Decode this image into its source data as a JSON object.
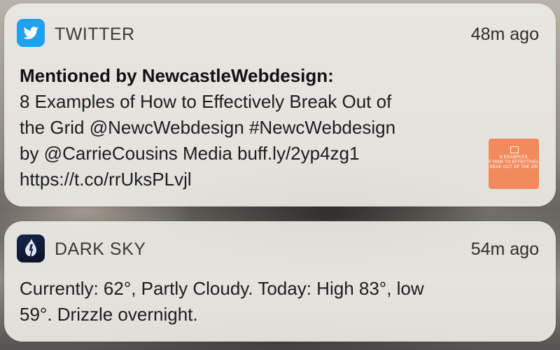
{
  "notifications": {
    "twitter": {
      "app_name": "TWITTER",
      "time": "48m ago",
      "title": "Mentioned by NewcastleWebdesign:",
      "lines": [
        "8 Examples of How to Effectively Break Out of",
        "the Grid @NewcWebdesign #NewcWebdesign",
        "by @CarrieCousins Media buff.ly/2yp4zg1",
        "https://t.co/rrUksPLvjl"
      ],
      "thumbnail": {
        "lines": [
          "8 EXAMPLES",
          "F HOW TO EFFECTIVEL",
          "REAK OUT OF THE GR"
        ]
      },
      "icon": "twitter-bird-icon",
      "accent": "#1da1f2"
    },
    "darksky": {
      "app_name": "DARK SKY",
      "time": "54m ago",
      "lines": [
        "Currently: 62°, Partly Cloudy. Today:  High 83°, low",
        "59°. Drizzle overnight."
      ],
      "icon": "dark-sky-raindrop-icon",
      "accent": "#16254a"
    }
  }
}
